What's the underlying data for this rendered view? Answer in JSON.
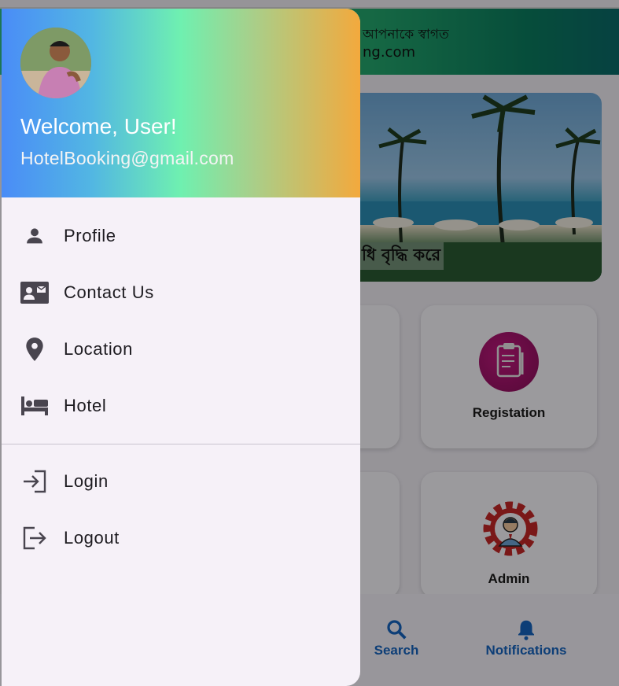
{
  "app": {
    "header_line1": "আপনাকে স্বাগত",
    "header_line2": "ng.com",
    "banner_caption": "ধি বৃদ্ধি করে",
    "cards": [
      {
        "label": "Registation",
        "icon": "clipboard-icon"
      },
      {
        "label": "Admin",
        "icon": "admin-gear-icon"
      }
    ],
    "bottom_nav": [
      {
        "label": "Search",
        "icon": "search-icon"
      },
      {
        "label": "Notifications",
        "icon": "bell-icon"
      }
    ],
    "accent_color": "#1565c0"
  },
  "drawer": {
    "welcome": "Welcome, User!",
    "email": "HotelBooking@gmail.com",
    "header_gradient": [
      "#4a8cf7",
      "#6ff0b0",
      "#f3a93d"
    ],
    "menu": [
      {
        "label": "Profile",
        "icon": "person-icon"
      },
      {
        "label": "Contact Us",
        "icon": "contact-card-icon"
      },
      {
        "label": "Location",
        "icon": "location-pin-icon"
      },
      {
        "label": "Hotel",
        "icon": "bed-icon"
      }
    ],
    "auth_menu": [
      {
        "label": "Login",
        "icon": "login-icon"
      },
      {
        "label": "Logout",
        "icon": "logout-icon"
      }
    ]
  }
}
